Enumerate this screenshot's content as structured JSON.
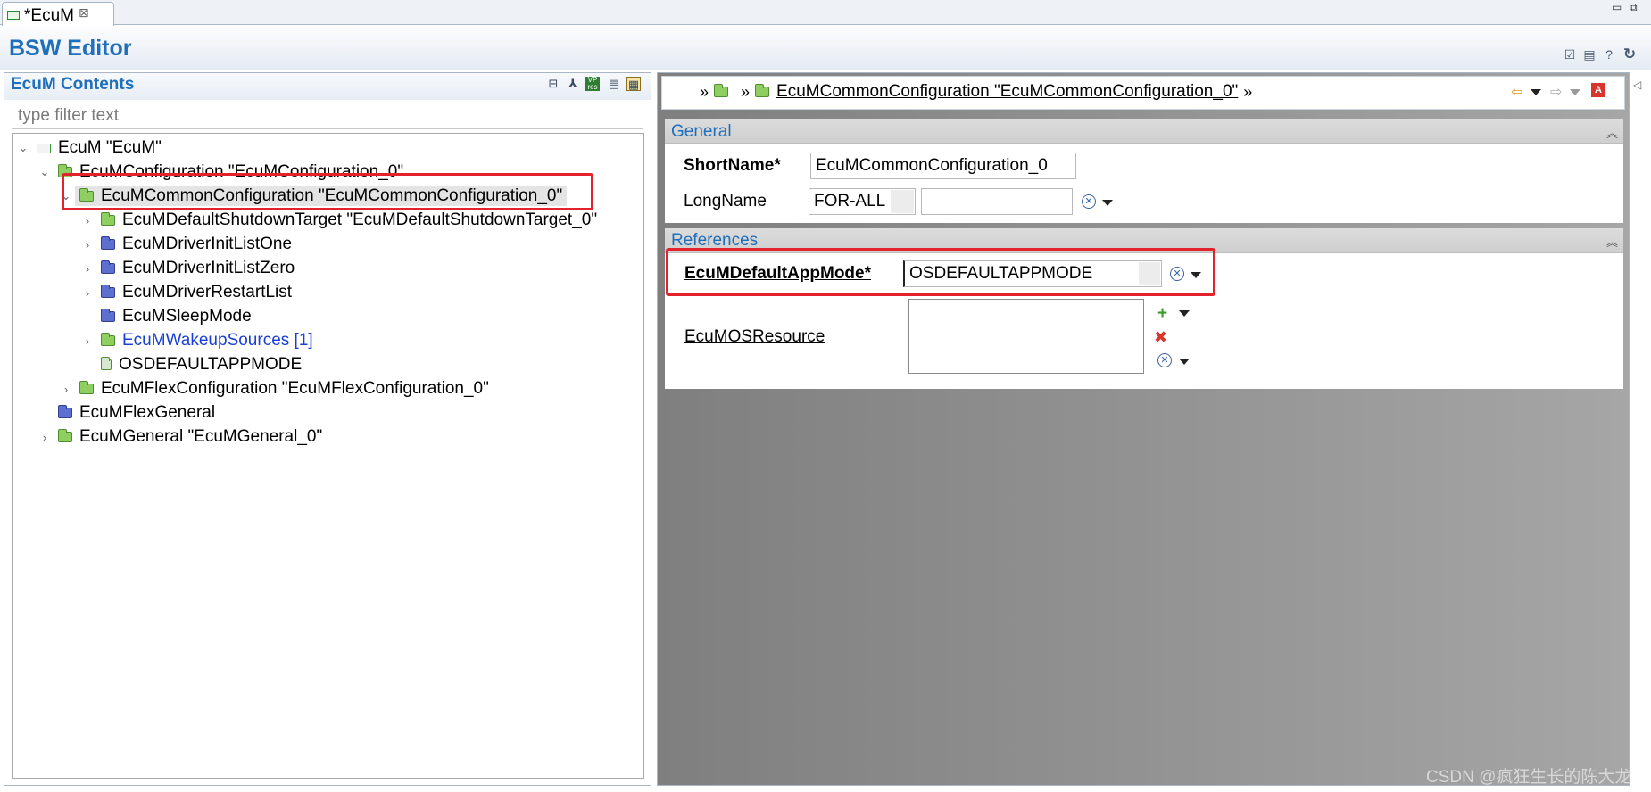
{
  "window": {
    "tab_label": "*EcuM",
    "tab_close": "⊠"
  },
  "editor": {
    "title": "BSW Editor"
  },
  "left_panel": {
    "title": "EcuM Contents",
    "filter_placeholder": "type filter text",
    "toolbar_icons": [
      "collapse-all-icon",
      "link-icon",
      "vp-res-icon",
      "document-icon",
      "table-icon"
    ],
    "vp_badge": "VP\nres"
  },
  "tree": {
    "items": [
      {
        "label": "EcuM \"EcuM\"",
        "depth": 0,
        "expanded": true,
        "icon": "instance"
      },
      {
        "label": "EcuMConfiguration \"EcuMConfiguration_0\"",
        "depth": 1,
        "expanded": true,
        "icon": "green-folder"
      },
      {
        "label": "EcuMCommonConfiguration \"EcuMCommonConfiguration_0\"",
        "depth": 2,
        "expanded": true,
        "icon": "green-folder",
        "selected": true
      },
      {
        "label": "EcuMDefaultShutdownTarget \"EcuMDefaultShutdownTarget_0\"",
        "depth": 3,
        "expanded": false,
        "icon": "green-folder"
      },
      {
        "label": "EcuMDriverInitListOne",
        "depth": 3,
        "expanded": false,
        "icon": "blue-folder"
      },
      {
        "label": "EcuMDriverInitListZero",
        "depth": 3,
        "expanded": false,
        "icon": "blue-folder"
      },
      {
        "label": "EcuMDriverRestartList",
        "depth": 3,
        "expanded": false,
        "icon": "blue-folder"
      },
      {
        "label": "EcuMSleepMode",
        "depth": 3,
        "expanded": null,
        "icon": "blue-folder"
      },
      {
        "label": "EcuMWakeupSources [1]",
        "depth": 3,
        "expanded": false,
        "icon": "green-folder",
        "link": true
      },
      {
        "label": "OSDEFAULTAPPMODE",
        "depth": 3,
        "expanded": null,
        "icon": "reference"
      },
      {
        "label": "EcuMFlexConfiguration \"EcuMFlexConfiguration_0\"",
        "depth": 2,
        "expanded": false,
        "icon": "green-folder"
      },
      {
        "label": "EcuMFlexGeneral",
        "depth": 1,
        "expanded": null,
        "icon": "blue-folder"
      },
      {
        "label": "EcuMGeneral \"EcuMGeneral_0\"",
        "depth": 1,
        "expanded": false,
        "icon": "green-folder"
      }
    ]
  },
  "breadcrumb": {
    "label": "EcuMCommonConfiguration \"EcuMCommonConfiguration_0\"",
    "sep": "»",
    "nav_icons": [
      "back-icon",
      "forward-icon",
      "autosar-icon"
    ]
  },
  "general": {
    "title": "General",
    "shortname_label": "ShortName*",
    "shortname_value": "EcuMCommonConfiguration_0",
    "longname_label": "LongName",
    "longname_lang": "FOR-ALL",
    "longname_value": ""
  },
  "references": {
    "title": "References",
    "default_app_mode_label": "EcuMDefaultAppMode*",
    "default_app_mode_value": "OSDEFAULTAPPMODE",
    "os_resource_label": "EcuMOSResource"
  },
  "watermark": "CSDN @疯狂生长的陈大龙",
  "colors": {
    "accent": "#1f6fbb",
    "highlight": "#e3232c",
    "link": "#1a3fd6"
  }
}
